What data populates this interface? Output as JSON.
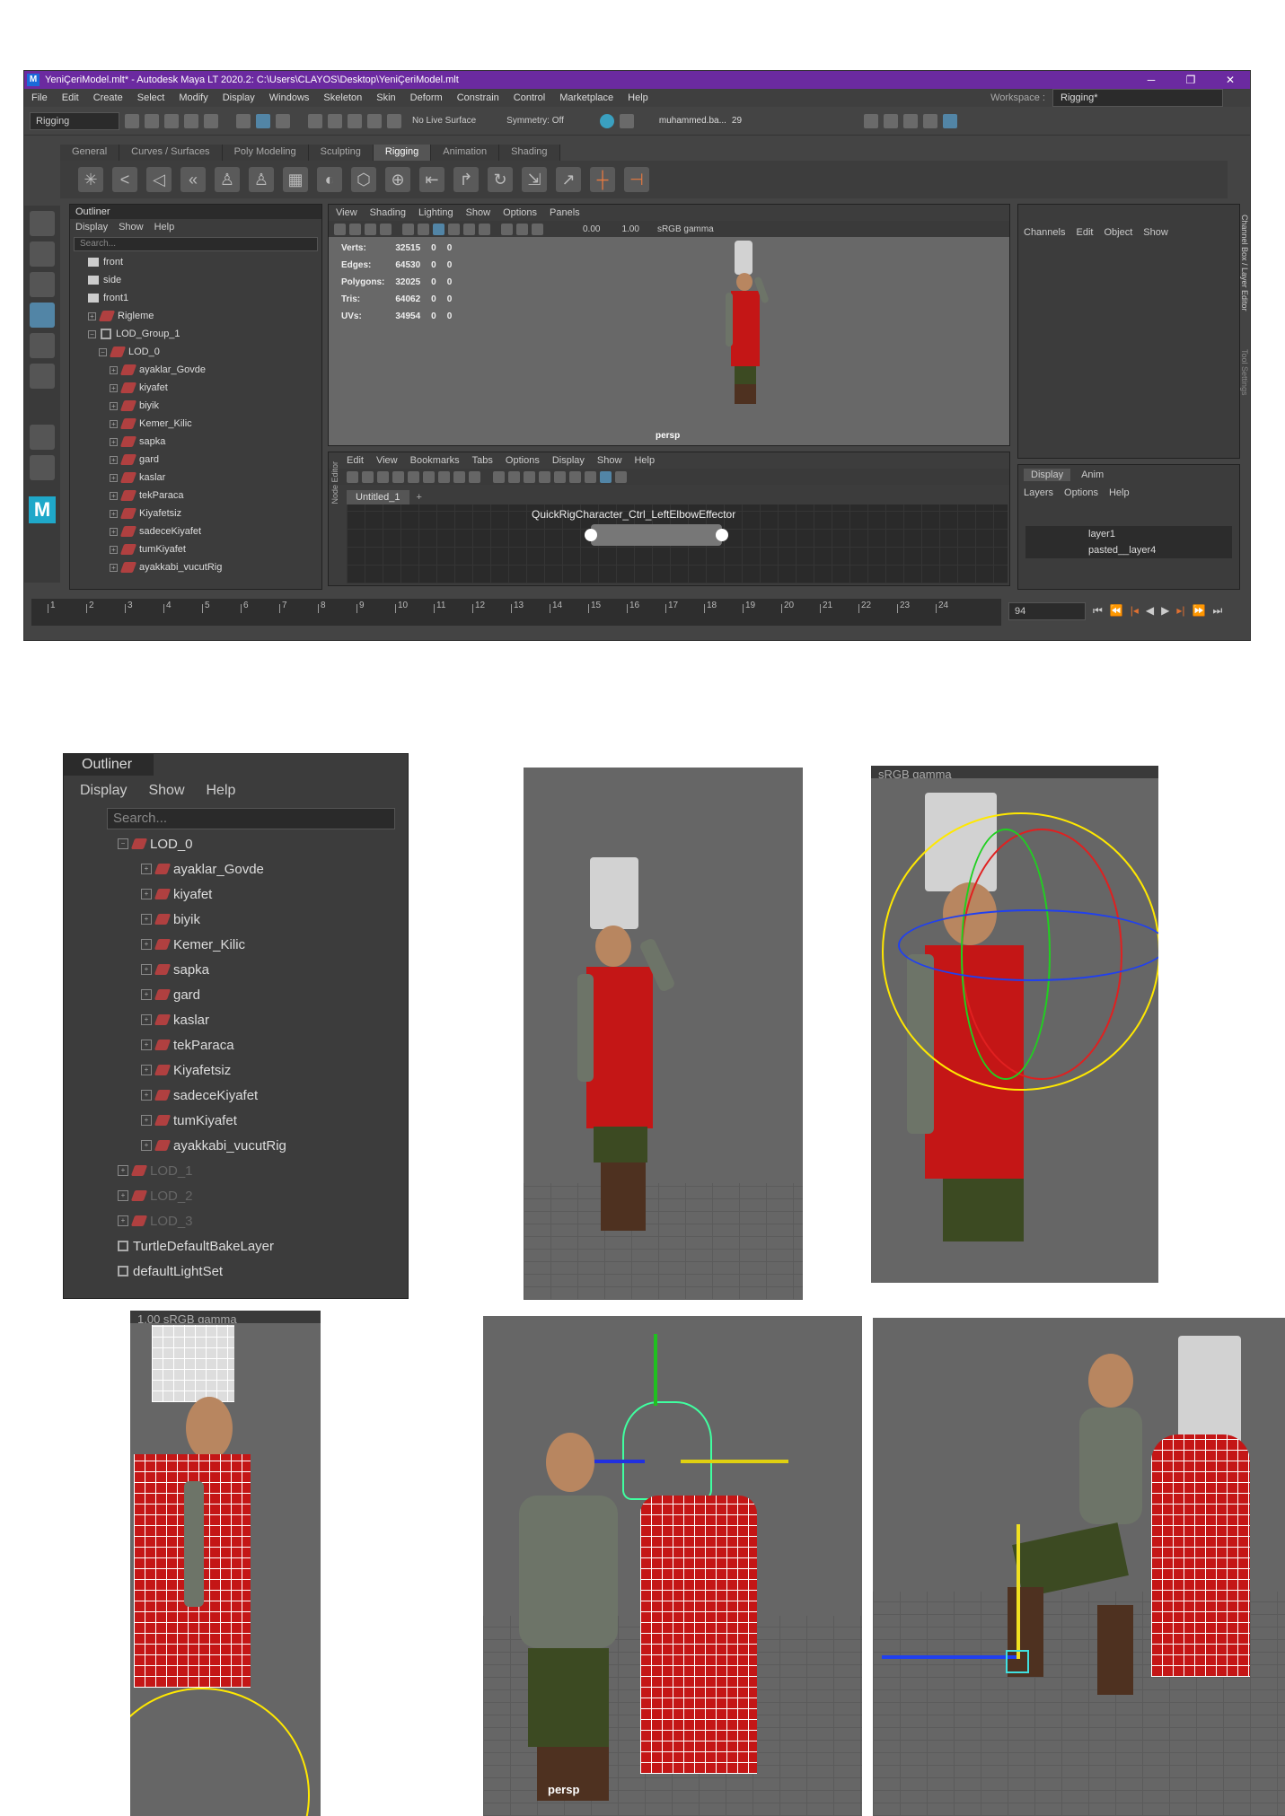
{
  "window": {
    "title": "YeniÇeriModel.mlt* - Autodesk Maya LT 2020.2: C:\\Users\\CLAYOS\\Desktop\\YeniÇeriModel.mlt",
    "workspace_label": "Workspace :",
    "workspace_value": "Rigging*"
  },
  "menubar": [
    "File",
    "Edit",
    "Create",
    "Select",
    "Modify",
    "Display",
    "Windows",
    "Skeleton",
    "Skin",
    "Deform",
    "Constrain",
    "Control",
    "Marketplace",
    "Help"
  ],
  "toolbar": {
    "mode": "Rigging",
    "live_surface": "No Live Surface",
    "symmetry": "Symmetry: Off",
    "user": "muhammed.ba...",
    "notifications": "29"
  },
  "shelf_tabs": [
    "General",
    "Curves / Surfaces",
    "Poly Modeling",
    "Sculpting",
    "Rigging",
    "Animation",
    "Shading"
  ],
  "shelf_active": "Rigging",
  "outliner": {
    "title": "Outliner",
    "menu": [
      "Display",
      "Show",
      "Help"
    ],
    "search_placeholder": "Search...",
    "items": [
      "front",
      "side",
      "front1",
      "Rigleme",
      "LOD_Group_1",
      "LOD_0",
      "ayaklar_Govde",
      "kiyafet",
      "biyik",
      "Kemer_Kilic",
      "sapka",
      "gard",
      "kaslar",
      "tekParaca",
      "Kiyafetsiz",
      "sadeceKiyafet",
      "tumKiyafet",
      "ayakkabi_vucutRig"
    ]
  },
  "viewport": {
    "menu": [
      "View",
      "Shading",
      "Lighting",
      "Show",
      "Options",
      "Panels"
    ],
    "exposure": "0.00",
    "gamma": "1.00",
    "colorspace": "sRGB gamma",
    "camera": "persp",
    "stats": [
      {
        "label": "Verts:",
        "v1": "32515",
        "v2": "0",
        "v3": "0"
      },
      {
        "label": "Edges:",
        "v1": "64530",
        "v2": "0",
        "v3": "0"
      },
      {
        "label": "Polygons:",
        "v1": "32025",
        "v2": "0",
        "v3": "0"
      },
      {
        "label": "Tris:",
        "v1": "64062",
        "v2": "0",
        "v3": "0"
      },
      {
        "label": "UVs:",
        "v1": "34954",
        "v2": "0",
        "v3": "0"
      }
    ]
  },
  "node_editor": {
    "menu": [
      "Edit",
      "View",
      "Bookmarks",
      "Tabs",
      "Options",
      "Display",
      "Show",
      "Help"
    ],
    "tab": "Untitled_1",
    "add_tab": "+",
    "node": "QuickRigCharacter_Ctrl_LeftElbowEffector",
    "side_label": "Node Editor"
  },
  "channel_box": {
    "menu": [
      "Channels",
      "Edit",
      "Object",
      "Show"
    ],
    "side_label": "Channel Box / Layer Editor",
    "tool_label": "Tool Settings"
  },
  "layer_editor": {
    "tabs": [
      "Display",
      "Anim"
    ],
    "menu": [
      "Layers",
      "Options",
      "Help"
    ],
    "layers": [
      "layer1",
      "pasted__layer4"
    ]
  },
  "timeline": {
    "ticks": [
      "1",
      "2",
      "3",
      "4",
      "5",
      "6",
      "7",
      "8",
      "9",
      "10",
      "11",
      "12",
      "13",
      "14",
      "15",
      "16",
      "17",
      "18",
      "19",
      "20",
      "21",
      "22",
      "23",
      "24"
    ],
    "current_frame": "94"
  },
  "zoom_outliner": {
    "title": "Outliner",
    "menu": [
      "Display",
      "Show",
      "Help"
    ],
    "search_placeholder": "Search...",
    "items": [
      "LOD_0",
      "ayaklar_Govde",
      "kiyafet",
      "biyik",
      "Kemer_Kilic",
      "sapka",
      "gard",
      "kaslar",
      "tekParaca",
      "Kiyafetsiz",
      "sadeceKiyafet",
      "tumKiyafet",
      "ayakkabi_vucutRig",
      "LOD_1",
      "LOD_2",
      "LOD_3",
      "TurtleDefaultBakeLayer",
      "defaultLightSet"
    ]
  },
  "crops": {
    "srgb1": "sRGB gamma",
    "srgb2": "1.00    sRGB gamma",
    "srgb3": "sRGB gamma",
    "persp": "persp"
  },
  "colors": {
    "titlebar": "#6b2aa0",
    "accent": "#5285a6",
    "red": "#c41616"
  }
}
